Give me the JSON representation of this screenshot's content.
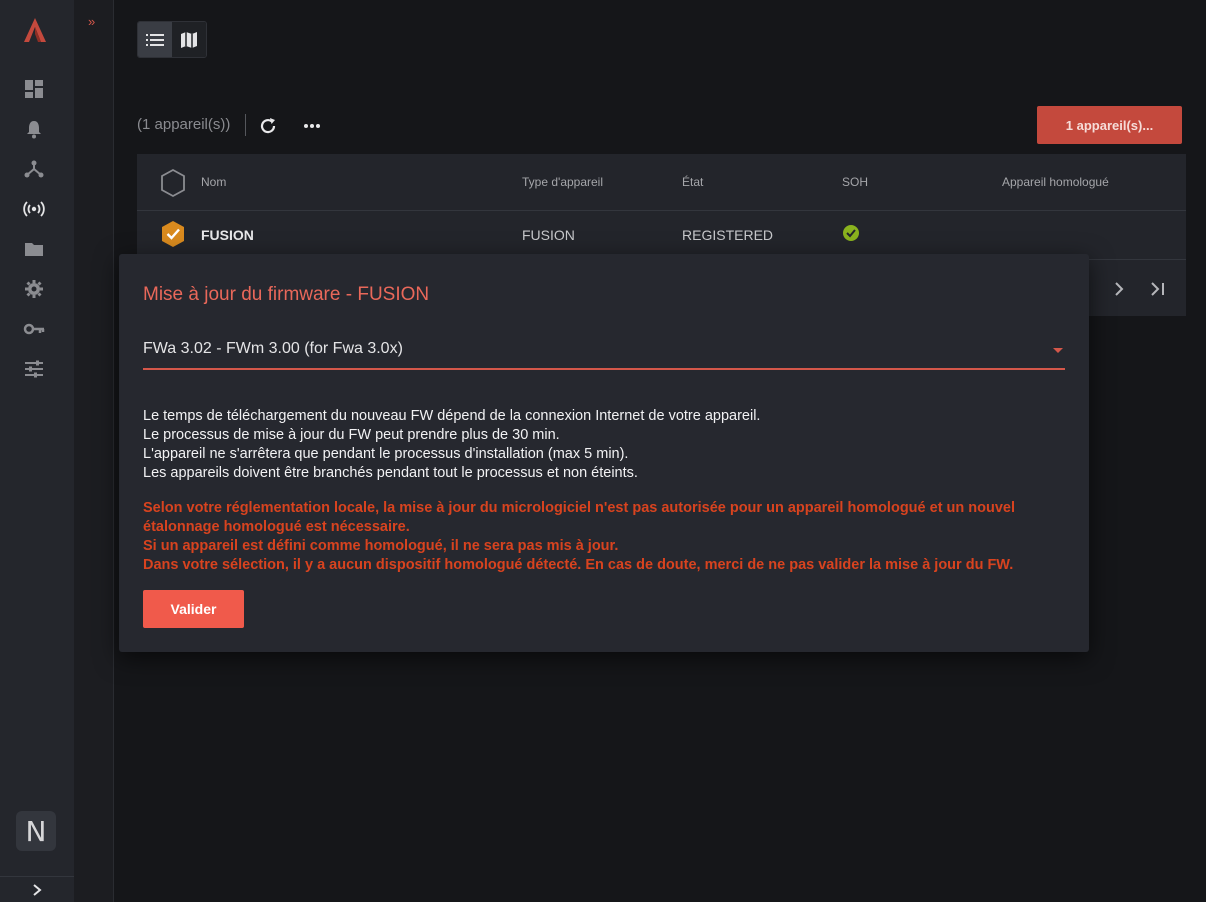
{
  "sidebar": {
    "logo": "app-logo",
    "icons": [
      "dashboard-icon",
      "bell-icon",
      "network-icon",
      "broadcast-icon",
      "folder-icon",
      "gear-icon",
      "key-icon",
      "sliders-icon"
    ],
    "avatar_letter": "N",
    "collapse_glyph": "›",
    "expand_glyph": "»"
  },
  "toolbar": {
    "count_text": "(1 appareil(s))",
    "action_label": "1 appareil(s)..."
  },
  "table": {
    "headers": {
      "name": "Nom",
      "type": "Type d'appareil",
      "state": "État",
      "soh": "SOH",
      "certified": "Appareil homologué"
    },
    "rows": [
      {
        "name": "FUSION",
        "type": "FUSION",
        "state": "REGISTERED",
        "soh": "ok",
        "certified": ""
      }
    ]
  },
  "dialog": {
    "title": "Mise à jour du firmware - FUSION",
    "selected_firmware": "FWa 3.02 - FWm 3.00 (for Fwa 3.0x)",
    "info_lines": [
      "Le temps de téléchargement du nouveau FW dépend de la connexion Internet de votre appareil.",
      "Le processus de mise à jour du FW peut prendre plus de 30 min.",
      "L'appareil ne s'arrêtera que pendant le processus d'installation (max 5 min).",
      "Les appareils doivent être branchés pendant tout le processus et non éteints."
    ],
    "warning_lines": [
      "Selon votre réglementation locale, la mise à jour du micrologiciel n'est pas autorisée pour un appareil homologué et un nouvel étalonnage homologué est nécessaire.",
      "Si un appareil est défini comme homologué, il ne sera pas mis à jour.",
      "Dans votre sélection, il y a aucun dispositif homologué détecté. En cas de doute, merci de ne pas valider la mise à jour du FW."
    ],
    "validate_label": "Valider"
  },
  "colors": {
    "accent": "#c4493d",
    "warning": "#d8431f",
    "ok": "#8ab31e",
    "hex_selected": "#d98a1e"
  }
}
